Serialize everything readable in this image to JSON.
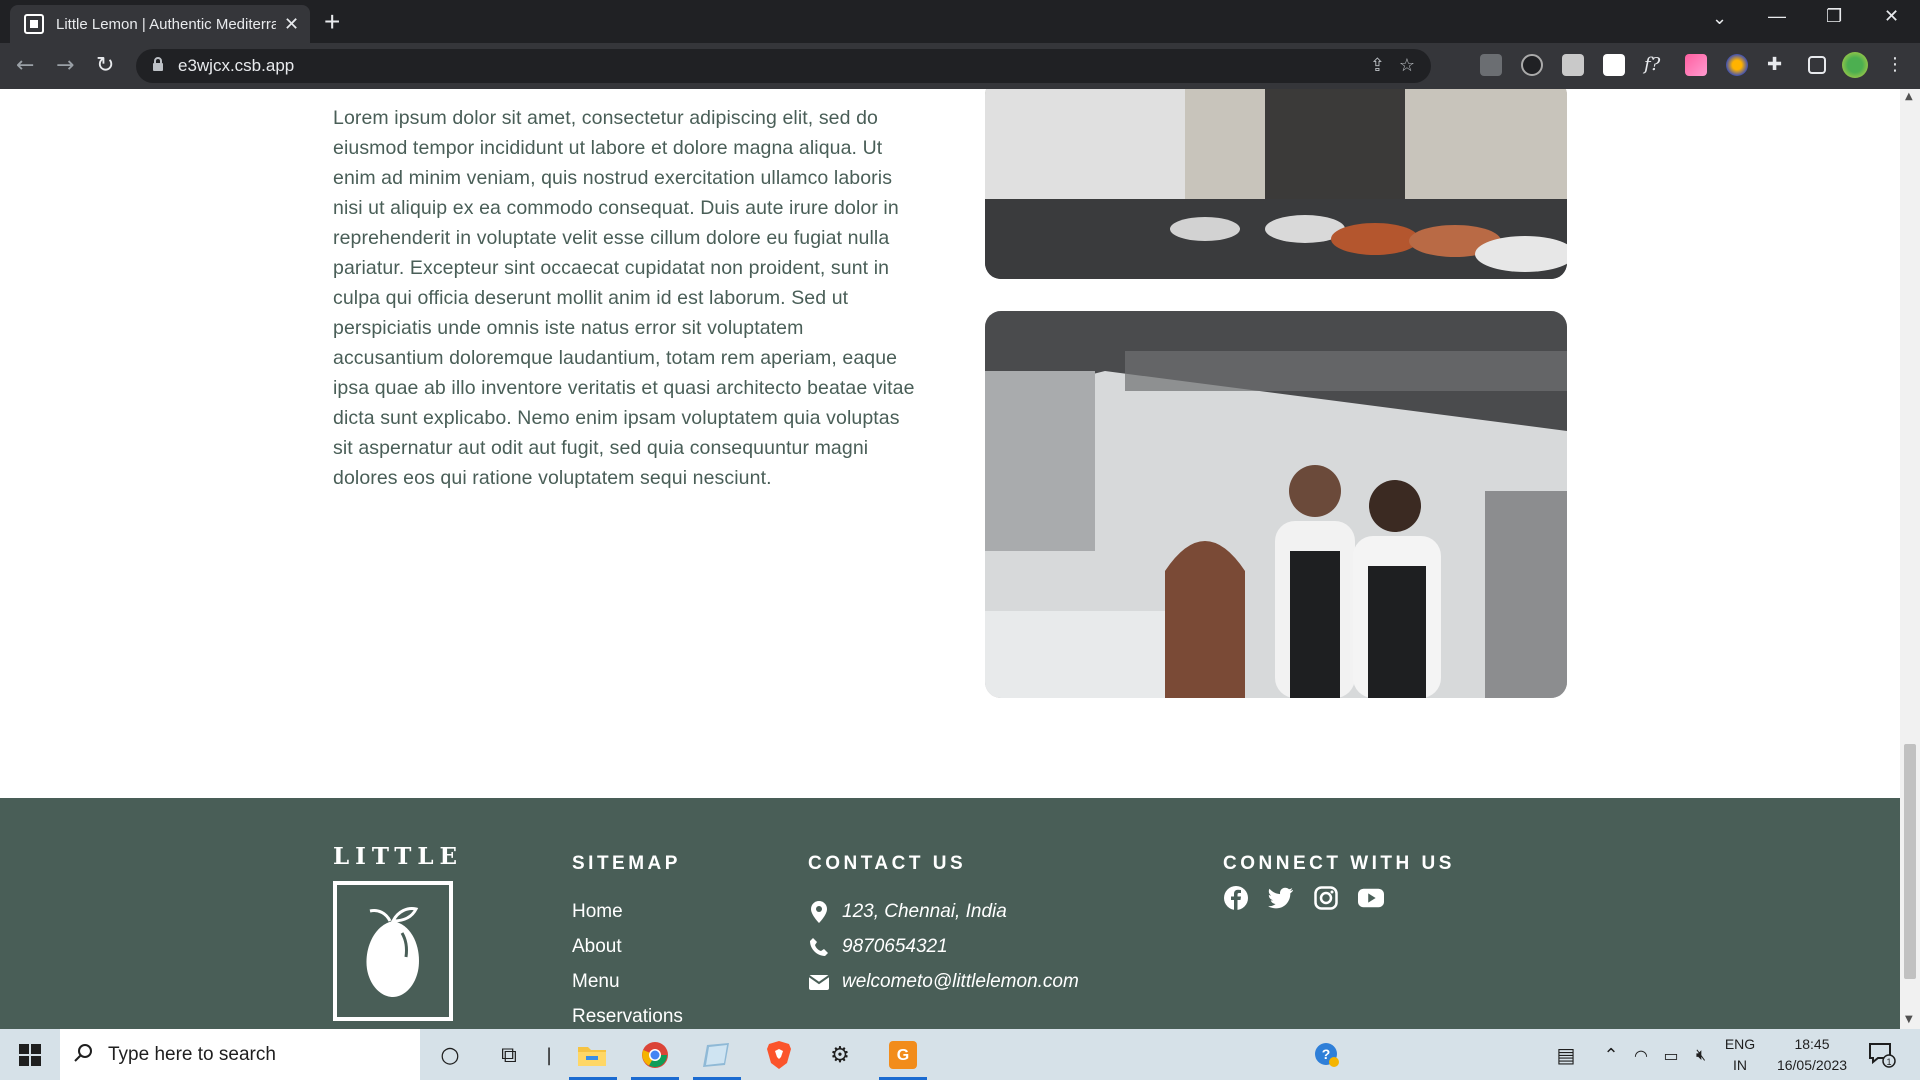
{
  "browser": {
    "tab_title": "Little Lemon | Authentic Mediterranean",
    "url": "e3wjcx.csb.app",
    "new_tab": "+",
    "close_tab": "✕"
  },
  "content": {
    "lorem": "Lorem ipsum dolor sit amet, consectetur adipiscing elit, sed do eiusmod tempor incididunt ut labore et dolore magna aliqua. Ut enim ad minim veniam, quis nostrud exercitation ullamco laboris nisi ut aliquip ex ea commodo consequat. Duis aute irure dolor in reprehenderit in voluptate velit esse cillum dolore eu fugiat nulla pariatur. Excepteur sint occaecat cupidatat non proident, sunt in culpa qui officia deserunt mollit anim id est laborum. Sed ut perspiciatis unde omnis iste natus error sit voluptatem accusantium doloremque laudantium, totam rem aperiam, eaque ipsa quae ab illo inventore veritatis et quasi architecto beatae vitae dicta sunt explicabo. Nemo enim ipsam voluptatem quia voluptas sit aspernatur aut odit aut fugit, sed quia consequuntur magni dolores eos qui ratione voluptatem sequi nesciunt."
  },
  "footer": {
    "logo_text": "LITTLE",
    "sitemap": {
      "heading": "SITEMAP",
      "links": [
        "Home",
        "About",
        "Menu",
        "Reservations"
      ]
    },
    "contact": {
      "heading": "CONTACT US",
      "address": "123, Chennai, India",
      "phone": "9870654321",
      "email": "welcometo@littlelemon.com"
    },
    "connect": {
      "heading": "CONNECT WITH US",
      "icons": [
        "facebook-icon",
        "twitter-icon",
        "instagram-icon",
        "youtube-icon"
      ]
    },
    "colors": {
      "background": "#495e57",
      "text": "#ffffff"
    }
  },
  "taskbar": {
    "search_placeholder": "Type here to search",
    "lang_top": "ENG",
    "lang_bottom": "IN",
    "time": "18:45",
    "date": "16/05/2023",
    "notification_count": "1"
  }
}
